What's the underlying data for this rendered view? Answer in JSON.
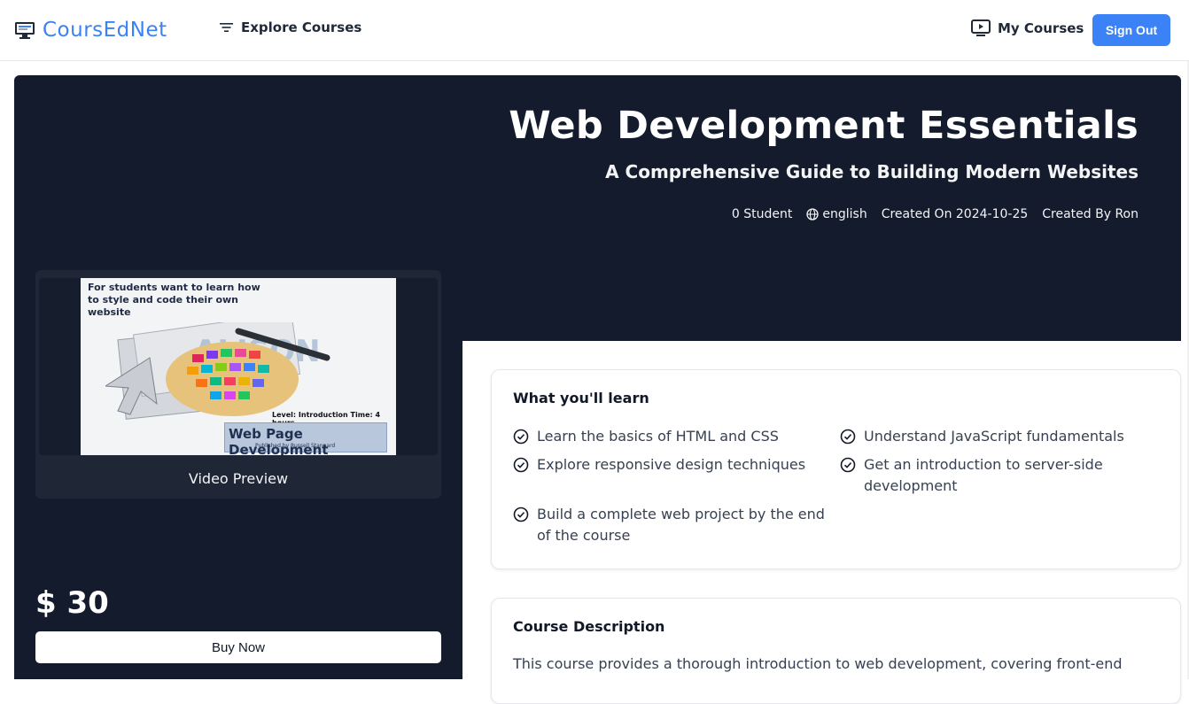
{
  "header": {
    "brand": "CoursEdNet",
    "explore_label": "Explore Courses",
    "mycourses_label": "My Courses",
    "signout_label": "Sign Out"
  },
  "course": {
    "title": "Web Development Essentials",
    "subtitle": "A Comprehensive Guide to Building Modern Websites",
    "students": "0 Student",
    "language": "english",
    "created_on": "Created On 2024-10-25",
    "created_by": "Created By Ron"
  },
  "video": {
    "label": "Video Preview",
    "thumb_caption": "For students want to learn how to style and code their own website",
    "thumb_level": "Level: Introduction  Time: 4 hours",
    "thumb_banner": "Web Page Development",
    "thumb_publisher": "Published by Russell Stannard"
  },
  "purchase": {
    "price": "$ 30",
    "buy_label": "Buy Now"
  },
  "learn": {
    "heading": "What you'll learn",
    "items": [
      "Learn the basics of HTML and CSS",
      "Understand JavaScript fundamentals",
      "Explore responsive design techniques",
      "Get an introduction to server-side development",
      "Build a complete web project by the end of the course"
    ]
  },
  "description": {
    "heading": "Course Description",
    "text": "This course provides a thorough introduction to web development, covering front-end"
  },
  "colors": {
    "accent": "#3b82f6",
    "hero_bg": "#141b2d"
  }
}
